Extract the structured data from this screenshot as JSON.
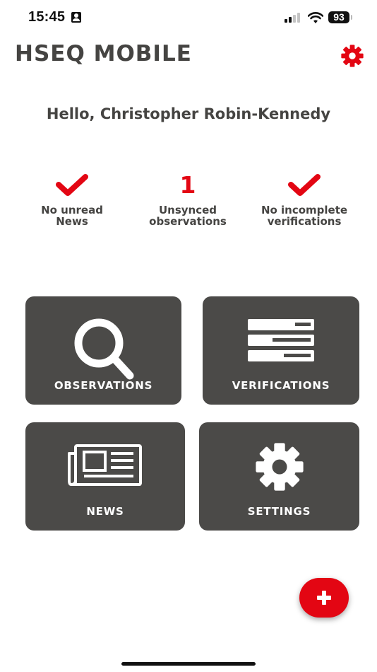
{
  "status_bar": {
    "time": "15:45",
    "battery_level": "93"
  },
  "header": {
    "title": "HSEQ MOBILE",
    "settings_icon": "gear-icon"
  },
  "greeting": "Hello, Christopher Robin-Kennedy",
  "stats": {
    "news": {
      "label": "No unread\nNews",
      "mark": "check-icon"
    },
    "observations": {
      "count": "1",
      "label": "Unsynced\nobservations"
    },
    "verifications": {
      "label": "No incomplete\nverifications",
      "mark": "check-icon"
    }
  },
  "tiles": {
    "observations": {
      "label": "OBSERVATIONS",
      "icon": "search-icon"
    },
    "verifications": {
      "label": "VERIFICATIONS",
      "icon": "list-icon"
    },
    "news": {
      "label": "NEWS",
      "icon": "newspaper-icon"
    },
    "settings": {
      "label": "SETTINGS",
      "icon": "gear-icon"
    }
  },
  "fab": {
    "icon": "plus-icon"
  },
  "colors": {
    "accent": "#e30613",
    "tile_bg": "#4b4a48",
    "text": "#454442"
  }
}
